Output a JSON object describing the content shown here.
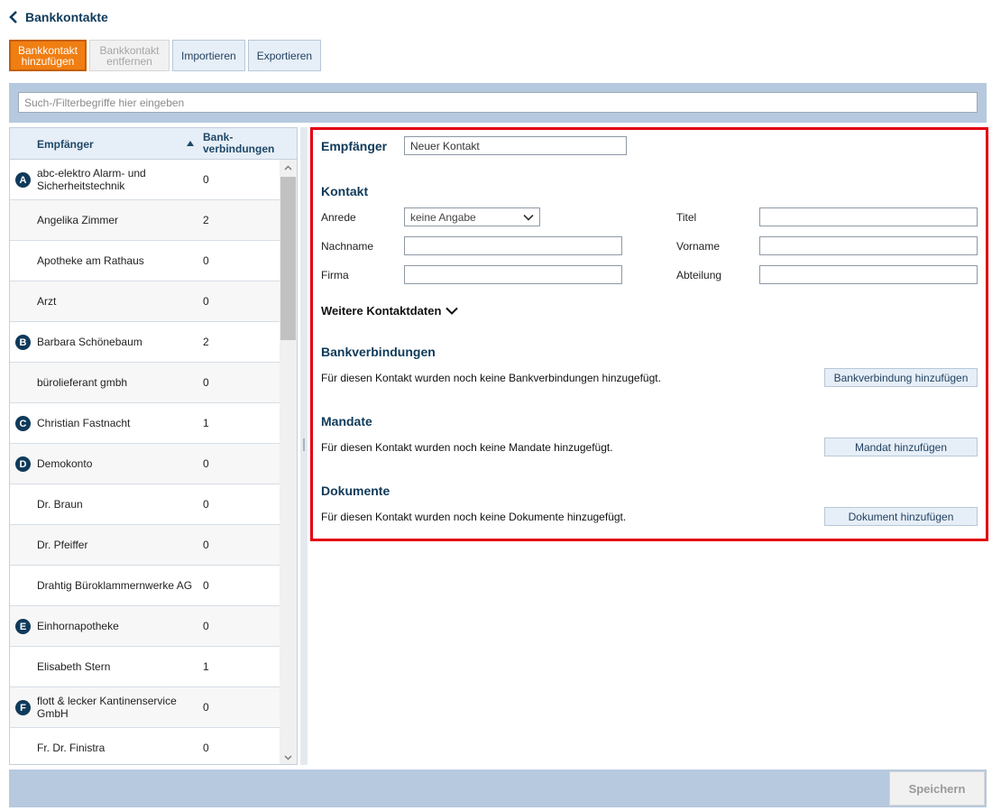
{
  "header": {
    "title": "Bankkontakte"
  },
  "toolbar": {
    "add_line1": "Bankkontakt",
    "add_line2": "hinzufügen",
    "remove_line1": "Bankkontakt",
    "remove_line2": "entfernen",
    "import": "Importieren",
    "export": "Exportieren"
  },
  "search": {
    "placeholder": "Such-/Filterbegriffe hier eingeben"
  },
  "list": {
    "col_name": "Empfänger",
    "col_bank_line1": "Bank-",
    "col_bank_line2": "verbindungen",
    "rows": [
      {
        "letter": "A",
        "name": "abc-elektro Alarm- und Sicherheitstechnik",
        "count": "0"
      },
      {
        "letter": "",
        "name": "Angelika Zimmer",
        "count": "2"
      },
      {
        "letter": "",
        "name": "Apotheke am Rathaus",
        "count": "0"
      },
      {
        "letter": "",
        "name": "Arzt",
        "count": "0"
      },
      {
        "letter": "B",
        "name": "Barbara Schönebaum",
        "count": "2"
      },
      {
        "letter": "",
        "name": "bürolieferant gmbh",
        "count": "0"
      },
      {
        "letter": "C",
        "name": "Christian Fastnacht",
        "count": "1"
      },
      {
        "letter": "D",
        "name": "Demokonto",
        "count": "0"
      },
      {
        "letter": "",
        "name": "Dr. Braun",
        "count": "0"
      },
      {
        "letter": "",
        "name": "Dr. Pfeiffer",
        "count": "0"
      },
      {
        "letter": "",
        "name": "Drahtig Büroklammernwerke AG",
        "count": "0"
      },
      {
        "letter": "E",
        "name": "Einhornapotheke",
        "count": "0"
      },
      {
        "letter": "",
        "name": "Elisabeth Stern",
        "count": "1"
      },
      {
        "letter": "F",
        "name": "flott & lecker Kantinenservice GmbH",
        "count": "0"
      },
      {
        "letter": "",
        "name": "Fr. Dr. Finistra",
        "count": "0"
      }
    ]
  },
  "detail": {
    "recipient_label": "Empfänger",
    "recipient_value": "Neuer Kontakt",
    "contact_title": "Kontakt",
    "anrede_label": "Anrede",
    "anrede_value": "keine Angabe",
    "titel_label": "Titel",
    "nachname_label": "Nachname",
    "vorname_label": "Vorname",
    "firma_label": "Firma",
    "abteilung_label": "Abteilung",
    "more_label": "Weitere Kontaktdaten",
    "bank_title": "Bankverbindungen",
    "bank_info": "Für diesen Kontakt wurden noch keine Bankverbindungen hinzugefügt.",
    "bank_button": "Bankverbindung hinzufügen",
    "mandate_title": "Mandate",
    "mandate_info": "Für diesen Kontakt wurden noch keine Mandate hinzugefügt.",
    "mandate_button": "Mandat hinzufügen",
    "docs_title": "Dokumente",
    "docs_info": "Für diesen Kontakt wurden noch keine Dokumente hinzugefügt.",
    "docs_button": "Dokument hinzufügen"
  },
  "footer": {
    "save": "Speichern"
  }
}
